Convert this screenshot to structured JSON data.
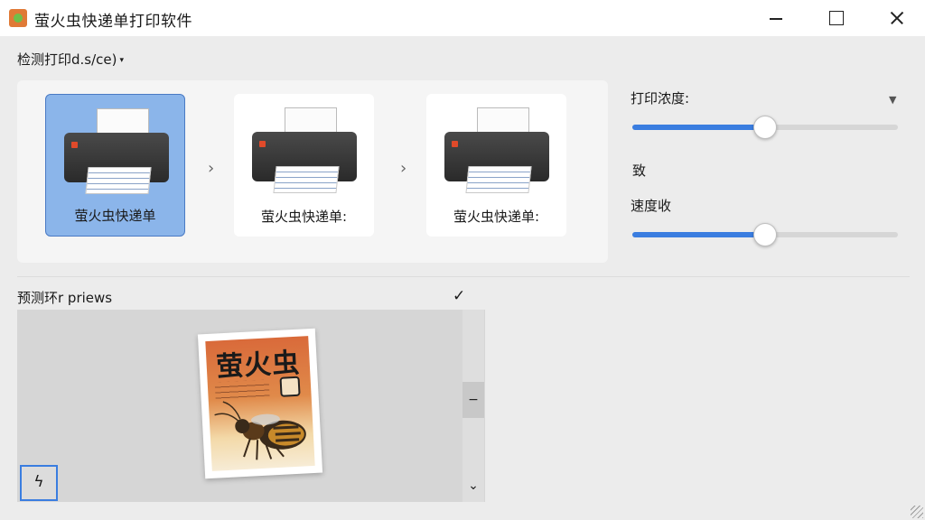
{
  "window": {
    "title": "萤火虫快递单打印软件",
    "minimize_icon": "minimize-icon",
    "maximize_icon": "maximize-icon",
    "close_icon": "close-icon"
  },
  "device_selector": {
    "label": "检测打印d.s/ce)",
    "caret": "▾"
  },
  "printers": [
    {
      "label": "萤火虫快递单",
      "selected": true
    },
    {
      "label": "萤火虫快递单:",
      "selected": false
    },
    {
      "label": "萤火虫快递单:",
      "selected": false
    }
  ],
  "separators": [
    "›",
    "›"
  ],
  "settings": {
    "density_label": "打印浓度:",
    "density_caret": "▼",
    "density_value": 0.5,
    "extra_label": "致",
    "speed_label": "速度收",
    "speed_value": 0.5,
    "accent_color": "#3a7de0"
  },
  "preview": {
    "label": "预测环r priews",
    "check": "✓",
    "card_title": "萤火虫",
    "scroll_up": "−",
    "scroll_down": "⌄",
    "tool_glyph": "ϟ"
  }
}
